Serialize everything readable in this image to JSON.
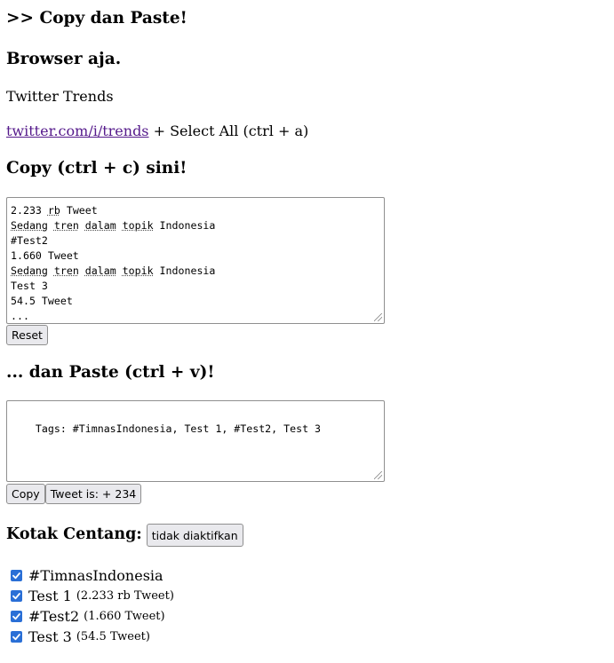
{
  "heading_prefix": ">>",
  "heading_title": "Copy dan Paste!",
  "section_browser": "Browser aja.",
  "twitter_trends": "Twitter Trends",
  "trends_link": "twitter.com/i/trends",
  "select_all": " + Select All (ctrl + a)",
  "copy_heading": "Copy (ctrl + c) sini!",
  "input_lines": [
    {
      "text": "2.233 ",
      "sq": "rb",
      "tail": " Tweet"
    },
    {
      "sq_words": [
        "Sedang",
        "tren",
        "dalam",
        "topik"
      ],
      "tail": " Indonesia"
    },
    {
      "text": "#Test2"
    },
    {
      "text": "1.660 Tweet"
    },
    {
      "sq_words": [
        "Sedang",
        "tren",
        "dalam",
        "topik"
      ],
      "tail": " Indonesia"
    },
    {
      "text": "Test 3"
    },
    {
      "text": "54.5 Tweet"
    },
    {
      "text": "..."
    }
  ],
  "reset_button": "Reset",
  "paste_heading": "... dan Paste (ctrl + v)!",
  "output_text": "Tags: #TimnasIndonesia, Test 1, #Test2, Test 3",
  "copy_button": "Copy",
  "tweet_button": "Tweet is: + 234",
  "kotak_label": "Kotak Centang:",
  "kotak_button": "tidak diaktifkan",
  "checkboxes": [
    {
      "label": "#TimnasIndonesia",
      "count": "",
      "checked": true
    },
    {
      "label": "Test 1",
      "count": "(2.233 rb Tweet)",
      "checked": true
    },
    {
      "label": "#Test2",
      "count": "(1.660 Tweet)",
      "checked": true
    },
    {
      "label": "Test 3",
      "count": "(54.5 Tweet)",
      "checked": true
    }
  ],
  "colors": {
    "checkbox": "#2a6fd6",
    "link": "#551a8b"
  }
}
